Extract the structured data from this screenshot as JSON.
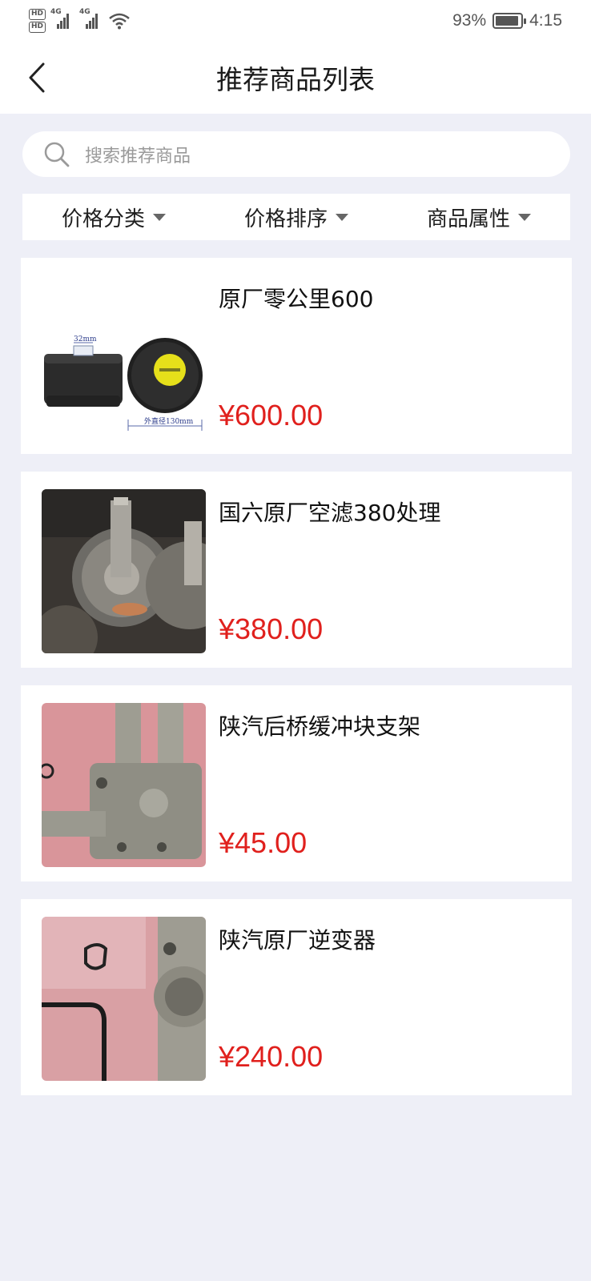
{
  "status_bar": {
    "hd1": "HD",
    "hd2": "HD",
    "net1": "4G",
    "net2": "4G",
    "battery": "93%",
    "time": "4:15",
    "battery_level": 0.93,
    "icons": [
      "signal-icon",
      "wifi-icon",
      "battery-icon"
    ]
  },
  "header": {
    "title": "推荐商品列表",
    "back_icon": "chevron-left-icon"
  },
  "search": {
    "placeholder": "搜索推荐商品",
    "icon": "search-icon"
  },
  "filters": [
    {
      "label": "价格分类"
    },
    {
      "label": "价格排序"
    },
    {
      "label": "商品属性"
    }
  ],
  "products": [
    {
      "name": "原厂零公里600",
      "price": "¥600.00",
      "thumb_caption_1": "32mm",
      "thumb_caption_2": "外直径130mm"
    },
    {
      "name": "国六原厂空滤380处理",
      "price": "¥380.00"
    },
    {
      "name": "陕汽后桥缓冲块支架",
      "price": "¥45.00"
    },
    {
      "name": "陕汽原厂逆变器",
      "price": "¥240.00"
    }
  ],
  "colors": {
    "background": "#eeeff7",
    "price": "#e0201d",
    "card": "#ffffff"
  }
}
